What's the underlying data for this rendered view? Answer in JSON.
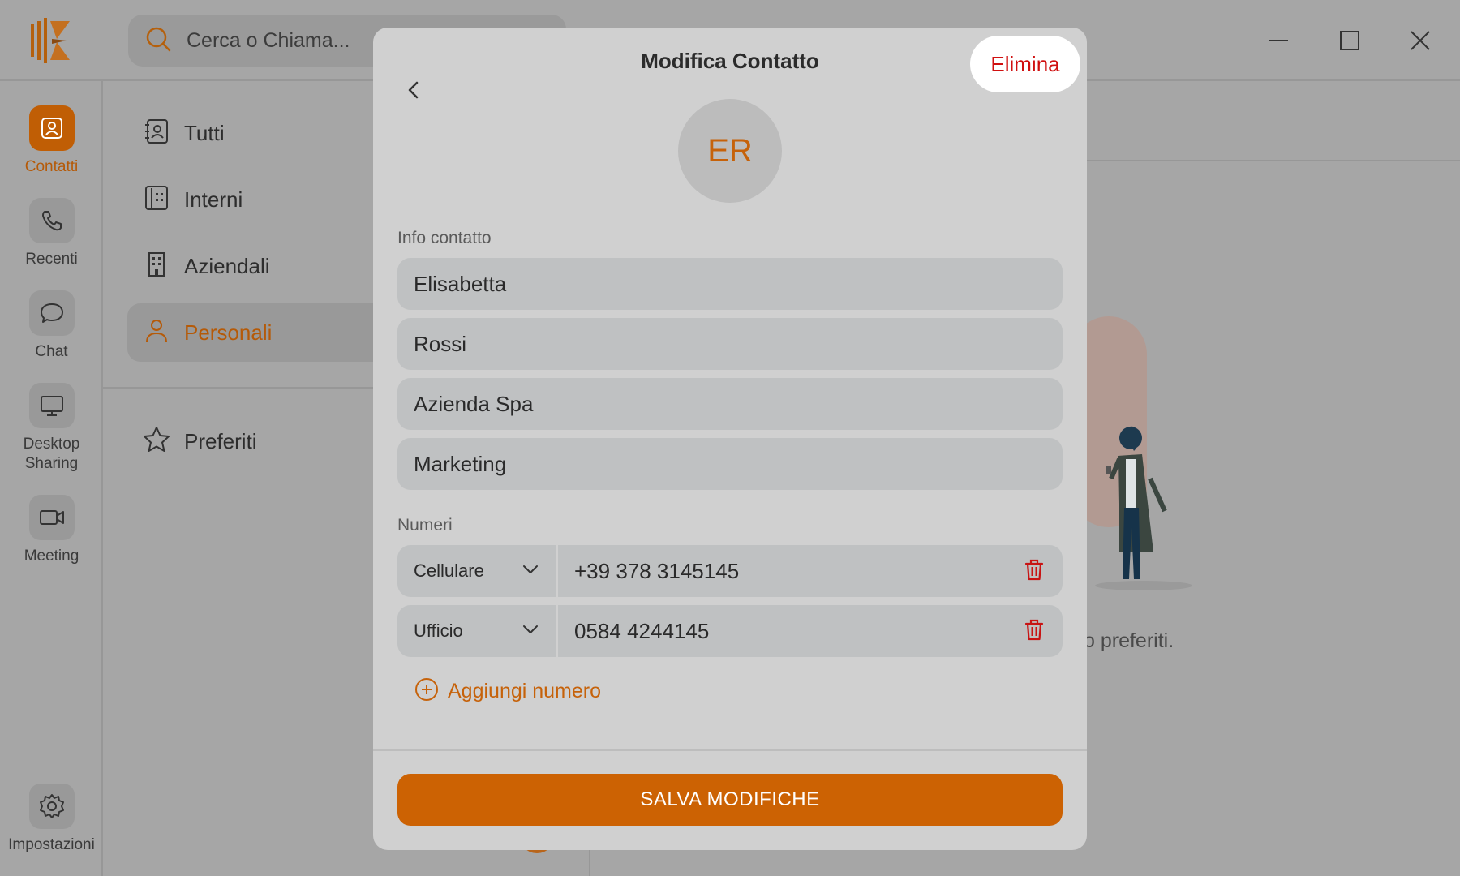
{
  "search": {
    "placeholder": "Cerca o Chiama..."
  },
  "rail": {
    "items": [
      {
        "label": "Contatti",
        "icon": "contacts-icon",
        "active": true
      },
      {
        "label": "Recenti",
        "icon": "phone-icon"
      },
      {
        "label": "Chat",
        "icon": "chat-bubble-icon"
      },
      {
        "label_line1": "Desktop",
        "label_line2": "Sharing",
        "icon": "monitor-icon"
      },
      {
        "label": "Meeting",
        "icon": "video-camera-icon"
      }
    ],
    "settings_label": "Impostazioni"
  },
  "nav": {
    "items": [
      {
        "label": "Tutti",
        "icon": "address-book-icon"
      },
      {
        "label": "Interni",
        "icon": "intercom-icon"
      },
      {
        "label": "Aziendali",
        "icon": "building-icon"
      },
      {
        "label": "Personali",
        "icon": "person-icon",
        "active": true
      }
    ],
    "favorites_label": "Preferiti"
  },
  "background": {
    "empty_text": "o preferiti."
  },
  "modal": {
    "title": "Modifica Contatto",
    "delete_label": "Elimina",
    "avatar_initials": "ER",
    "info_label": "Info contatto",
    "fields": {
      "first_name": "Elisabetta",
      "last_name": "Rossi",
      "company": "Azienda Spa",
      "department": "Marketing"
    },
    "numbers_label": "Numeri",
    "numbers": [
      {
        "type": "Cellulare",
        "value": "+39 378 3145145"
      },
      {
        "type": "Ufficio",
        "value": "0584 4244145"
      }
    ],
    "add_number_label": "Aggiungi numero",
    "save_label": "SALVA MODIFICHE"
  },
  "colors": {
    "accent": "#cc6203",
    "danger": "#d01010",
    "modal_bg": "#d0d0d0",
    "field_bg": "#bfc1c2",
    "backdrop": "#a6a6a6"
  }
}
